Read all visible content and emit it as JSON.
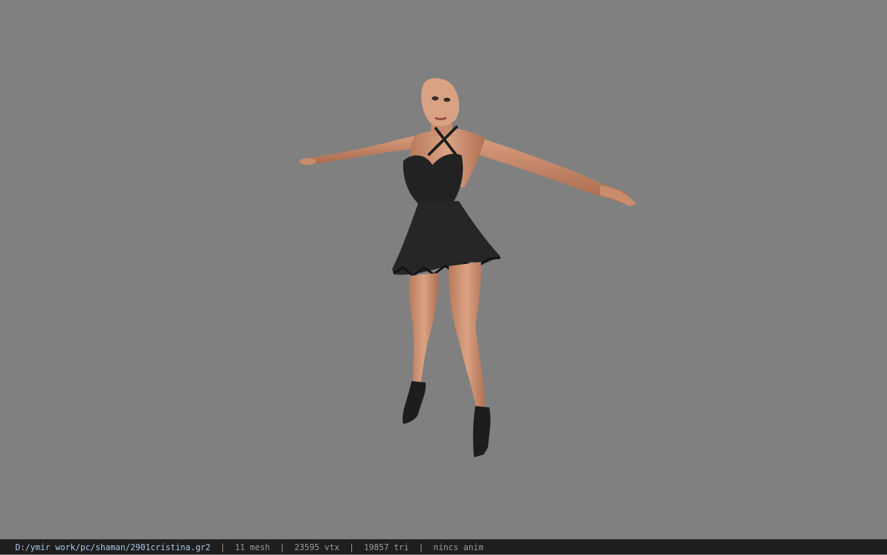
{
  "viewport": {
    "background": "#808080",
    "subject": "3d-character-model"
  },
  "statusbar": {
    "file_path": "D:/ymir work/pc/shaman/2901cristina.gr2",
    "mesh_count": "11 mesh",
    "vertex_count": "23595 vtx",
    "triangle_count": "19857 tri",
    "anim_status": "nincs anim",
    "separator": "|"
  }
}
